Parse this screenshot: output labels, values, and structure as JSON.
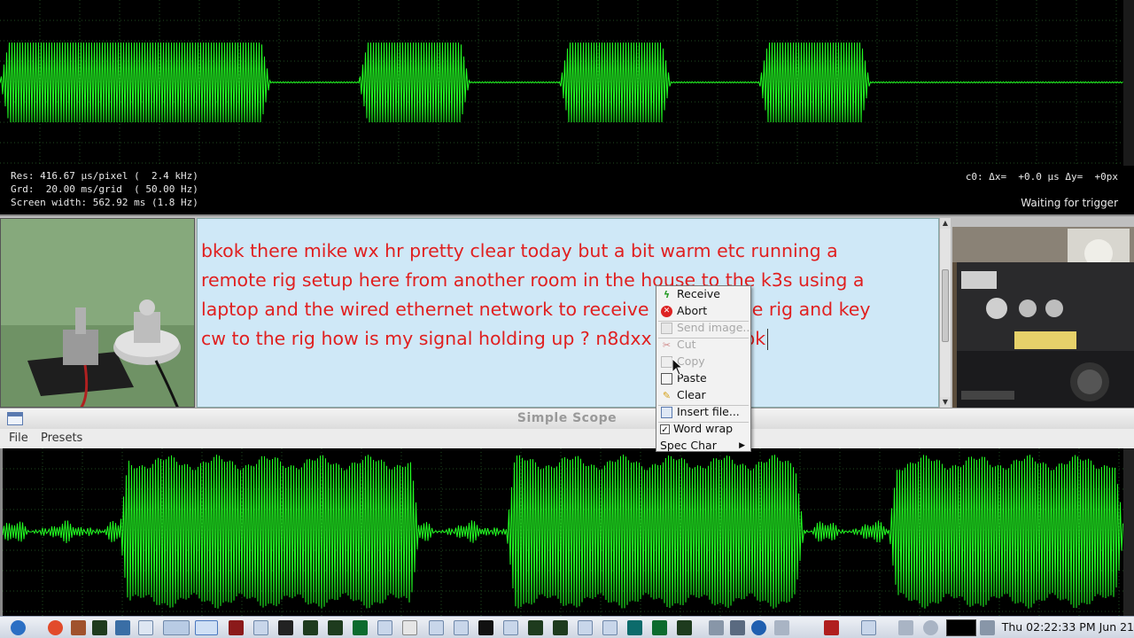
{
  "top_scope": {
    "res_line": "Res: 416.67 µs/pixel (  2.4 kHz)",
    "grid_line": "Grd:  20.00 ms/grid  ( 50.00 Hz)",
    "width_line": "Screen width: 562.92 ms (1.8 Hz)",
    "cursor_readout": "c0: Δx=  +0.0 µs Δy=  +0px",
    "trigger_status": "Waiting for trigger"
  },
  "rx_text": {
    "lines": [
      "bkok there mike  wx hr pretty clear today  but a bit warm  etc   running a",
      "remote rig setup here from another room in the house to the k3s   using a",
      "laptop and the wired ethernet network to receive cw from the rig and key",
      "cw to the rig    how is my signal holding up ? n8dxx de w8kw bk"
    ]
  },
  "lower_window": {
    "title": "Simple Scope",
    "menu": {
      "file": "File",
      "presets": "Presets"
    }
  },
  "context_menu": {
    "receive": "Receive",
    "abort": "Abort",
    "send_image": "Send image...",
    "cut": "Cut",
    "copy": "Copy",
    "paste": "Paste",
    "clear": "Clear",
    "insert_file": "Insert file...",
    "word_wrap": "Word wrap",
    "spec_char": "Spec Char"
  },
  "taskbar": {
    "clock": "Thu 02:22:33 PM Jun 21"
  },
  "colors": {
    "trace": "#22ff22",
    "grid": "#1f4a1f",
    "rx_text": "#e02020",
    "rx_background": "#cfe8f7"
  }
}
